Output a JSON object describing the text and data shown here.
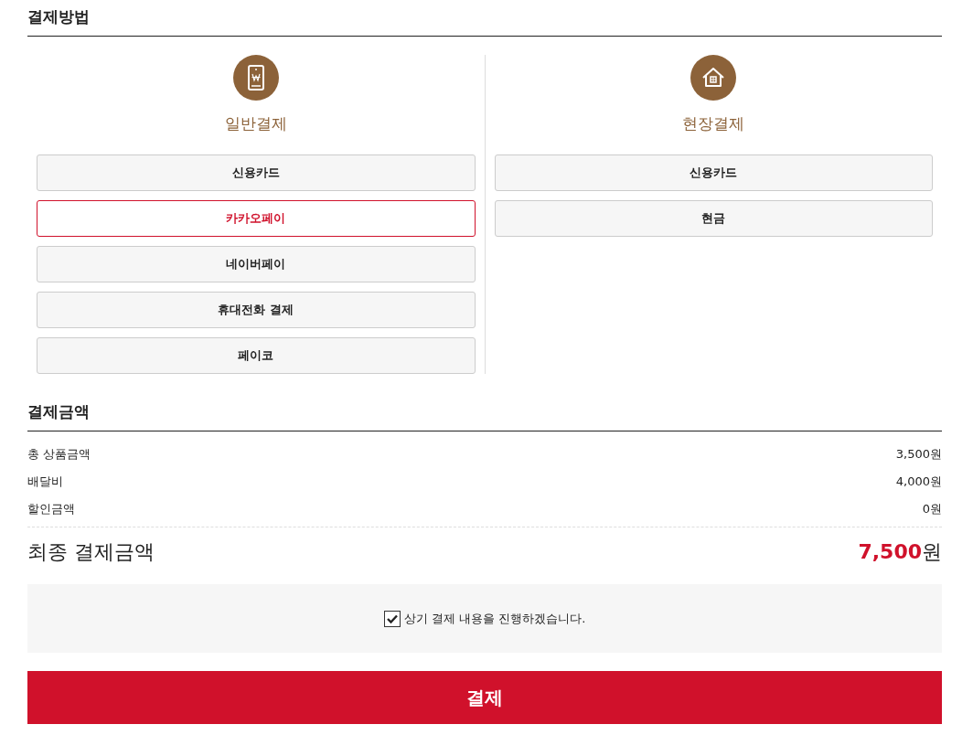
{
  "payment_method": {
    "title": "결제방법",
    "groups": [
      {
        "kind": "mobile",
        "label": "일반결제",
        "options": [
          {
            "label": "신용카드",
            "selected": false
          },
          {
            "label": "카카오페이",
            "selected": true
          },
          {
            "label": "네이버페이",
            "selected": false
          },
          {
            "label": "휴대전화 결제",
            "selected": false
          },
          {
            "label": "페이코",
            "selected": false
          }
        ]
      },
      {
        "kind": "onsite",
        "label": "현장결제",
        "options": [
          {
            "label": "신용카드",
            "selected": false
          },
          {
            "label": "현금",
            "selected": false
          }
        ]
      }
    ]
  },
  "payment_amount": {
    "title": "결제금액",
    "rows": [
      {
        "label": "총 상품금액",
        "value": "3,500원"
      },
      {
        "label": "배달비",
        "value": "4,000원"
      },
      {
        "label": "할인금액",
        "value": "0원"
      }
    ],
    "total": {
      "label": "최종 결제금액",
      "value": "**7,500**원"
    }
  },
  "agreement": {
    "label": "상기 결제 내용을 진행하겠습니다.",
    "checked": true
  },
  "pay_button": "결제"
}
